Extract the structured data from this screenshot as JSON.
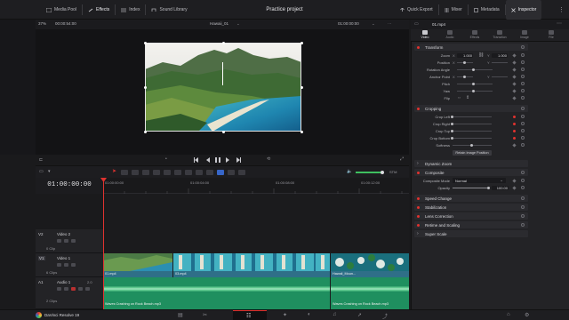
{
  "topbar": {
    "media_pool": "Media Pool",
    "effects": "Effects",
    "index": "Index",
    "sound_library": "Sound Library",
    "project_title": "Practice project",
    "quick_export": "Quick Export",
    "mixer": "Mixer",
    "metadata": "Metadata",
    "inspector": "Inspector"
  },
  "viewer": {
    "zoom": "37%",
    "timecode_left": "00:00:54:00",
    "timeline_name": "Hawaii_01",
    "timecode_right": "01:00:00:00",
    "zoom_small": "• • •"
  },
  "transport": {
    "in_out": "•"
  },
  "timeline": {
    "current_timecode": "01:00:00:00",
    "ruler_labels": [
      "01:00:00:00",
      "01:00:04:00",
      "01:00:08:00",
      "01:00:12:00"
    ],
    "volume_label": "STM"
  },
  "tracks": [
    {
      "id": "V2",
      "name": "Video 2",
      "clips": "0 Clip"
    },
    {
      "id": "V1",
      "name": "Video 1",
      "clips": "6 Clips"
    },
    {
      "id": "A1",
      "name": "Audio 1",
      "level": "2.0",
      "clips": "2 Clips"
    }
  ],
  "clips": {
    "video": [
      "01.mp4",
      "03.mp4",
      "Hawaii_Moun..."
    ],
    "audio": [
      "Waves Crashing on Rock Beach.mp3",
      "Waves Crashing on Rock Beach.mp3"
    ]
  },
  "inspector": {
    "clip_name": "01.mp4",
    "tabs": [
      "Video",
      "Audio",
      "Effects",
      "Transition",
      "Image",
      "File"
    ],
    "transform": {
      "title": "Transform",
      "zoom_label": "Zoom",
      "zoom_x": "1.000",
      "zoom_y": "1.000",
      "position_label": "Position",
      "rotation_label": "Rotation Angle",
      "anchor_label": "Anchor Point",
      "pitch_label": "Pitch",
      "yaw_label": "Yaw",
      "flip_label": "Flip",
      "x": "X",
      "y": "Y"
    },
    "cropping": {
      "title": "Cropping",
      "crop_left": "Crop Left",
      "crop_right": "Crop Right",
      "crop_top": "Crop Top",
      "crop_bottom": "Crop Bottom",
      "softness": "Softness",
      "retain": "Retain Image Position"
    },
    "dynamic_zoom": "Dynamic Zoom",
    "composite": {
      "title": "Composite",
      "mode_label": "Composite Mode",
      "mode_value": "Normal",
      "opacity_label": "Opacity",
      "opacity_value": "100.00"
    },
    "speed_change": "Speed Change",
    "stabilization": "Stabilization",
    "lens_correction": "Lens Correction",
    "retime": "Retime and Scaling",
    "super_scale": "Super Scale"
  },
  "bottombar": {
    "app_name": "DaVinci Resolve 19"
  },
  "colors": {
    "accent_red": "#e0322f",
    "video_clip": "#2f6f88",
    "audio_clip": "#1f8f5f"
  }
}
